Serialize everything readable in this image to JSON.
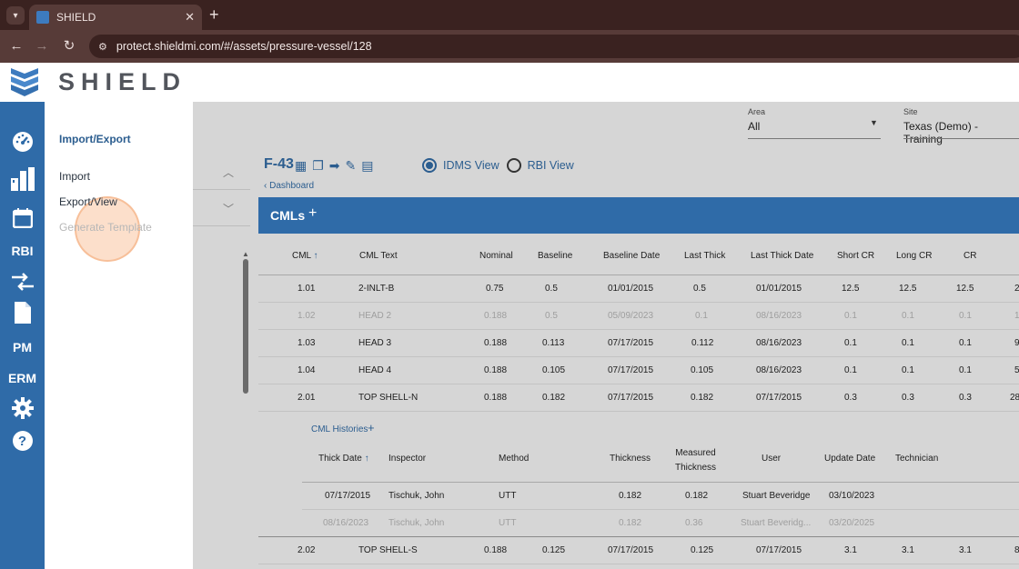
{
  "browser": {
    "tab_title": "SHIELD",
    "tab_close": "✕",
    "new_tab": "+",
    "url": "protect.shieldmi.com/#/assets/pressure-vessel/128"
  },
  "app": {
    "logo_text": "SHIELD"
  },
  "leftnav": {
    "rbi": "RBI",
    "pm": "PM",
    "erm": "ERM",
    "help": "?"
  },
  "submenu": {
    "title": "Import/Export",
    "items": [
      "Import",
      "Export/View",
      "Generate Template"
    ]
  },
  "filters": {
    "area_label": "Area",
    "area_value": "All",
    "site_label": "Site",
    "site_value": "Texas (Demo) - Training"
  },
  "asset": {
    "title": "F-43",
    "back_label": "Dashboard",
    "views": [
      "IDMS View",
      "RBI View"
    ],
    "selected_view": "IDMS View"
  },
  "cmls": {
    "title": "CMLs",
    "add": "+",
    "columns": [
      "CML",
      "CML Text",
      "Nominal",
      "Baseline",
      "Baseline Date",
      "Last Thick",
      "Last Thick Date",
      "Short CR",
      "Long CR",
      "CR"
    ],
    "rows": [
      [
        "1.01",
        "2-INLT-B",
        "0.75",
        "0.5",
        "01/01/2015",
        "0.5",
        "01/01/2015",
        "12.5",
        "12.5",
        "12.5",
        "2"
      ],
      [
        "1.02",
        "HEAD 2",
        "0.188",
        "0.5",
        "05/09/2023",
        "0.1",
        "08/16/2023",
        "0.1",
        "0.1",
        "0.1",
        "1"
      ],
      [
        "1.03",
        "HEAD 3",
        "0.188",
        "0.113",
        "07/17/2015",
        "0.112",
        "08/16/2023",
        "0.1",
        "0.1",
        "0.1",
        "9"
      ],
      [
        "1.04",
        "HEAD 4",
        "0.188",
        "0.105",
        "07/17/2015",
        "0.105",
        "08/16/2023",
        "0.1",
        "0.1",
        "0.1",
        "5"
      ],
      [
        "2.01",
        "TOP SHELL-N",
        "0.188",
        "0.182",
        "07/17/2015",
        "0.182",
        "07/17/2015",
        "0.3",
        "0.3",
        "0.3",
        "28"
      ]
    ],
    "last_row": [
      "2.02",
      "TOP SHELL-S",
      "0.188",
      "0.125",
      "07/17/2015",
      "0.125",
      "07/17/2015",
      "3.1",
      "3.1",
      "3.1",
      "8"
    ]
  },
  "histories": {
    "title": "CML Histories",
    "add": "+",
    "columns": [
      "Thick Date",
      "Inspector",
      "Method",
      "Thickness",
      "Measured",
      "Thickness",
      "User",
      "Update Date",
      "Technician"
    ],
    "rows": [
      [
        "07/17/2015",
        "Tischuk, John",
        "UTT",
        "0.182",
        "0.182",
        "Stuart Beveridge",
        "03/10/2023"
      ],
      [
        "08/16/2023",
        "Tischuk, John",
        "UTT",
        "0.182",
        "0.36",
        "Stuart Beveridg...",
        "03/20/2025"
      ]
    ]
  }
}
